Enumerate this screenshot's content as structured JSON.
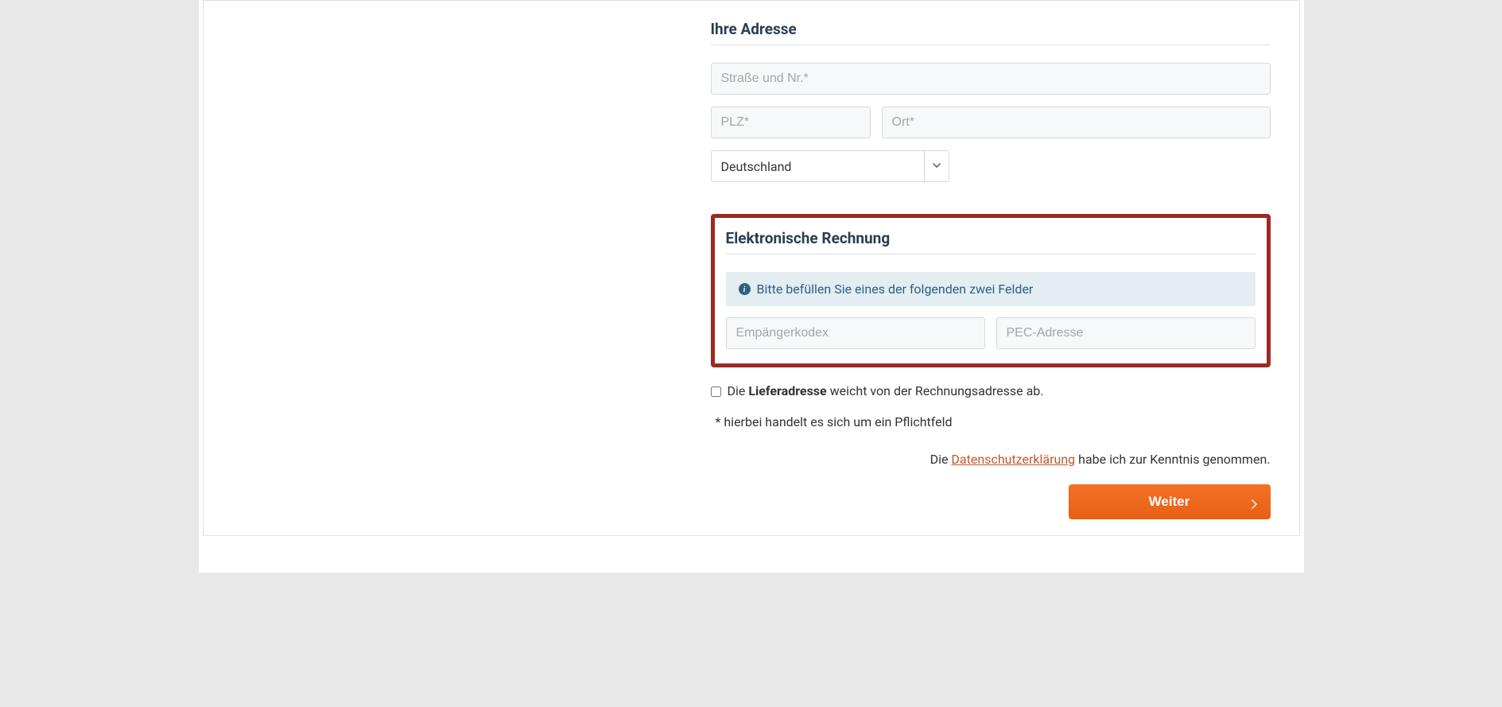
{
  "address_section": {
    "title": "Ihre Adresse",
    "street_placeholder": "Straße und Nr.*",
    "plz_placeholder": "PLZ*",
    "ort_placeholder": "Ort*",
    "country_selected": "Deutschland"
  },
  "einvoice_section": {
    "title": "Elektronische Rechnung",
    "info_text": "Bitte befüllen Sie eines der folgenden zwei Felder",
    "recipient_code_placeholder": "Empängerkodex",
    "pec_placeholder": "PEC-Adresse"
  },
  "delivery_checkbox": {
    "pre_text": "Die ",
    "bold_text": "Lieferadresse",
    "post_text": " weicht von der Rechnungsadresse ab."
  },
  "required_note": "* hierbei handelt es sich um ein Pflichtfeld",
  "privacy": {
    "pre_text": "Die ",
    "link_text": "Datenschutzerklärung",
    "post_text": " habe ich zur Kenntnis genommen."
  },
  "continue_button": "Weiter"
}
